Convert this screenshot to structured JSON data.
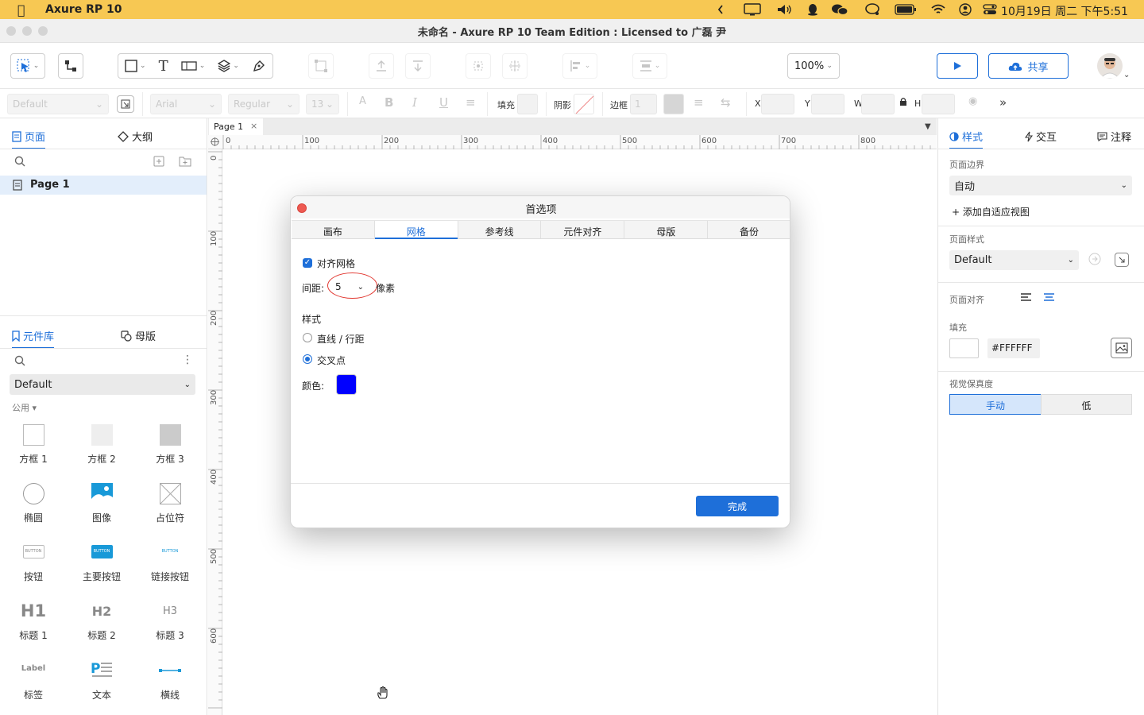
{
  "menubar": {
    "app_name": "Axure RP 10",
    "clock": "10月19日 周二 下午5:51",
    "icons": [
      "apple-icon",
      "chevron-left-icon",
      "display-icon",
      "volume-icon",
      "qq-icon",
      "wechat-icon",
      "chat-icon",
      "battery-icon",
      "wifi-icon",
      "user-icon",
      "control-center-icon"
    ]
  },
  "window": {
    "title": "未命名 - Axure RP 10 Team Edition : Licensed to 广磊 尹"
  },
  "toolbar": {
    "zoom": "100%",
    "share_label": "共享"
  },
  "formatbar": {
    "style_value": "Default",
    "font_value": "Arial",
    "weight_value": "Regular",
    "size_value": "13",
    "fill_label": "填充",
    "shadow_label": "阴影",
    "border_label": "边框",
    "border_value": "1",
    "x_label": "X",
    "y_label": "Y",
    "w_label": "W",
    "h_label": "H"
  },
  "left_panel": {
    "tabs": {
      "pages": "页面",
      "outline": "大纲"
    },
    "pages": [
      {
        "label": "Page 1"
      }
    ],
    "lib_tabs": {
      "library": "元件库",
      "masters": "母版"
    },
    "library_select": "Default",
    "category": "公用",
    "widgets": [
      {
        "label": "方框 1"
      },
      {
        "label": "方框 2"
      },
      {
        "label": "方框 3"
      },
      {
        "label": "椭圆"
      },
      {
        "label": "图像"
      },
      {
        "label": "占位符"
      },
      {
        "label": "按钮",
        "preview": "BUTTON"
      },
      {
        "label": "主要按钮",
        "preview": "BUTTON"
      },
      {
        "label": "链接按钮",
        "preview": "BUTTON"
      },
      {
        "label": "标题 1",
        "preview": "H1"
      },
      {
        "label": "标题 2",
        "preview": "H2"
      },
      {
        "label": "标题 3",
        "preview": "H3"
      },
      {
        "label": "标签",
        "preview": "Label"
      },
      {
        "label": "文本"
      },
      {
        "label": "横线"
      }
    ]
  },
  "canvas": {
    "tab_label": "Page 1",
    "h_ruler": [
      "0",
      "100",
      "200",
      "300",
      "400",
      "500",
      "600",
      "700",
      "800"
    ],
    "v_ruler": [
      "0",
      "100",
      "200",
      "300",
      "400",
      "500",
      "600"
    ]
  },
  "right_panel": {
    "tabs": {
      "style": "样式",
      "interactions": "交互",
      "notes": "注释"
    },
    "page_dimensions_label": "页面边界",
    "page_dimensions_value": "自动",
    "add_adaptive": "+ 添加自适应视图",
    "page_style_label": "页面样式",
    "page_style_value": "Default",
    "page_align_label": "页面对齐",
    "fill_label": "填充",
    "fill_value": "#FFFFFF",
    "fidelity_label": "视觉保真度",
    "fidelity_options": [
      "手动",
      "低"
    ]
  },
  "dialog": {
    "title": "首选项",
    "tabs": [
      "画布",
      "网格",
      "参考线",
      "元件对齐",
      "母版",
      "备份"
    ],
    "active_tab": "网格",
    "snap_label": "对齐网格",
    "spacing_label": "间距:",
    "spacing_value": "5",
    "unit": "像素",
    "style_label": "样式",
    "style_options": [
      "直线 / 行距",
      "交叉点"
    ],
    "color_label": "颜色:",
    "grid_color": "#0000FF",
    "done_label": "完成"
  },
  "colors": {
    "accent": "#1E6FD9",
    "menubar": "#F7C853",
    "annotation": "#E23A33"
  }
}
